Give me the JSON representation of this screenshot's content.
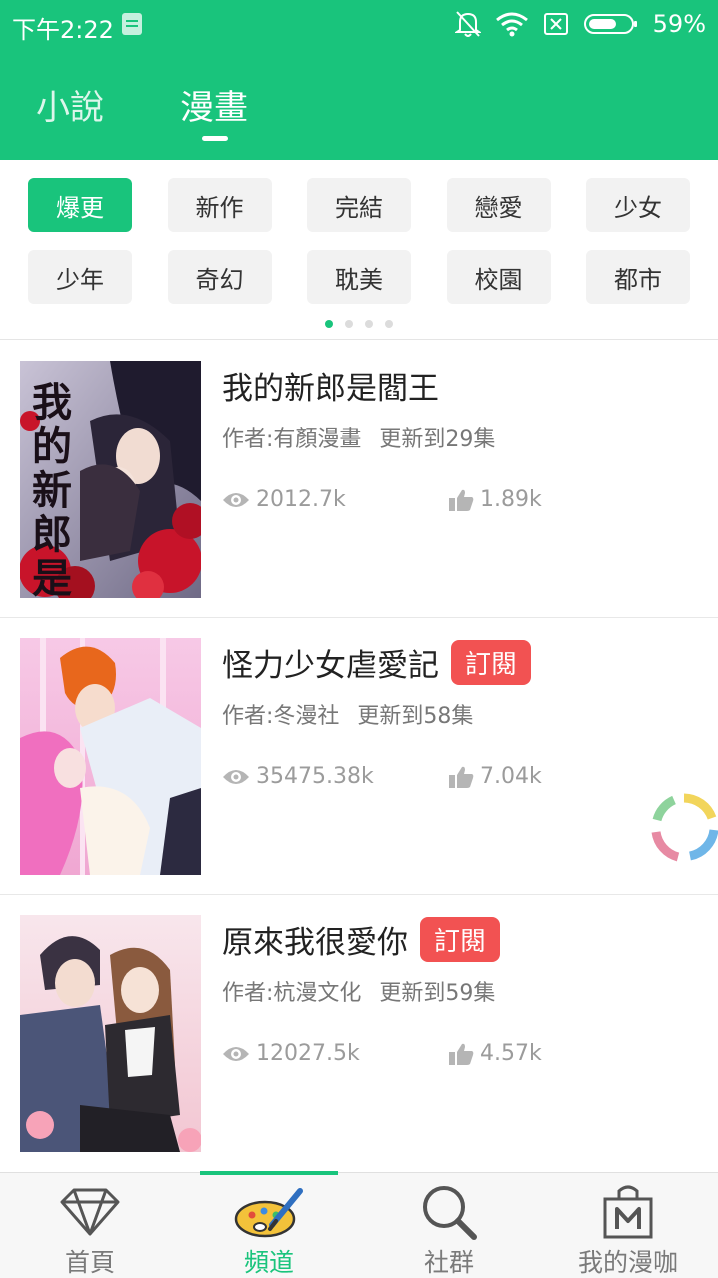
{
  "status_bar": {
    "time": "下午2:22",
    "battery": "59%"
  },
  "top_tabs": [
    {
      "label": "小說",
      "active": false
    },
    {
      "label": "漫畫",
      "active": true
    }
  ],
  "categories": [
    "爆更",
    "新作",
    "完結",
    "戀愛",
    "少女",
    "少年",
    "奇幻",
    "耽美",
    "校園",
    "都市"
  ],
  "category_page_indicator": {
    "pages": 4,
    "current": 1
  },
  "comics": [
    {
      "title": "我的新郎是閻王",
      "subscribe": "",
      "author": "作者:有顏漫畫",
      "update": "更新到29集",
      "views": "2012.7k",
      "likes": "1.89k",
      "cover_text": "我的新郎是閻王"
    },
    {
      "title": "怪力少女虐愛記",
      "subscribe": "訂閱",
      "author": "作者:冬漫社",
      "update": "更新到58集",
      "views": "35475.38k",
      "likes": "7.04k"
    },
    {
      "title": "原來我很愛你",
      "subscribe": "訂閱",
      "author": "作者:杭漫文化",
      "update": "更新到59集",
      "views": "12027.5k",
      "likes": "4.57k"
    }
  ],
  "bottom_nav": [
    {
      "label": "首頁",
      "icon": "diamond-icon",
      "active": false
    },
    {
      "label": "頻道",
      "icon": "palette-icon",
      "active": true
    },
    {
      "label": "社群",
      "icon": "search-icon",
      "active": false
    },
    {
      "label": "我的漫咖",
      "icon": "shopping-bag-icon",
      "active": false
    }
  ],
  "colors": {
    "brand": "#19c47c",
    "subscribe_badge": "#f25252"
  }
}
